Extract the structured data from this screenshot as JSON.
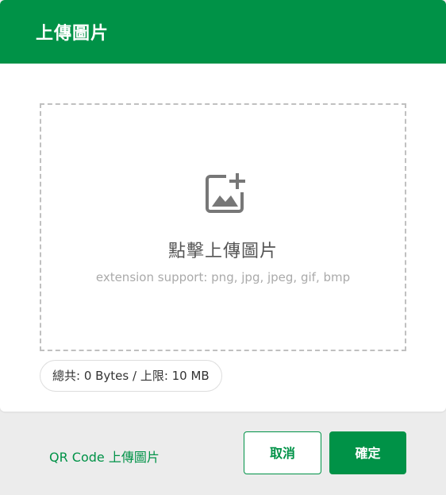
{
  "dialog": {
    "title": "上傳圖片"
  },
  "dropzone": {
    "icon": "add-image-icon",
    "title": "點擊上傳圖片",
    "hint": "extension support: png, jpg, jpeg, gif, bmp"
  },
  "size_info": {
    "text": "總共: 0 Bytes / 上限: 10 MB"
  },
  "footer": {
    "qr_link": "QR Code 上傳圖片",
    "cancel_label": "取消",
    "confirm_label": "確定"
  },
  "colors": {
    "brand_green": "#009247",
    "footer_bg": "#ececec",
    "dropzone_border": "#c0c0c0"
  }
}
